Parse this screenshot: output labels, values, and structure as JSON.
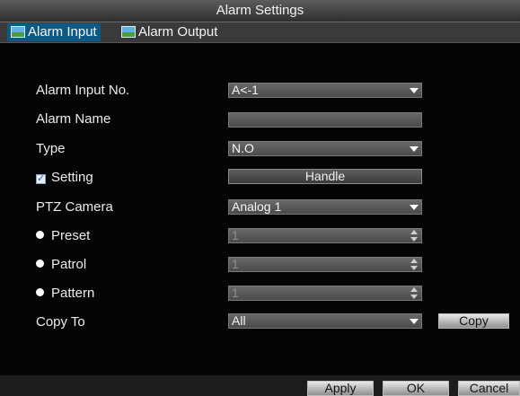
{
  "window": {
    "title": "Alarm Settings"
  },
  "tabs": [
    {
      "label": "Alarm Input",
      "icon": "picture-icon",
      "active": true
    },
    {
      "label": "Alarm Output",
      "icon": "picture-icon",
      "active": false
    }
  ],
  "form": {
    "alarm_input_no": {
      "label": "Alarm Input No.",
      "value": "A<-1"
    },
    "alarm_name": {
      "label": "Alarm Name",
      "value": ""
    },
    "type": {
      "label": "Type",
      "value": "N.O"
    },
    "setting": {
      "label": "Setting",
      "checked": true,
      "button_label": "Handle"
    },
    "ptz_camera": {
      "label": "PTZ Camera",
      "value": "Analog 1"
    },
    "preset": {
      "label": "Preset",
      "value": "1"
    },
    "patrol": {
      "label": "Patrol",
      "value": "1"
    },
    "pattern": {
      "label": "Pattern",
      "value": "1"
    },
    "copy_to": {
      "label": "Copy To",
      "value": "All",
      "button_label": "Copy"
    }
  },
  "footer": {
    "apply_label": "Apply",
    "ok_label": "OK",
    "cancel_label": "Cancel"
  },
  "colors": {
    "active_tab": "#0d5a86",
    "background": "#050505",
    "field": "#5a5a5a"
  }
}
